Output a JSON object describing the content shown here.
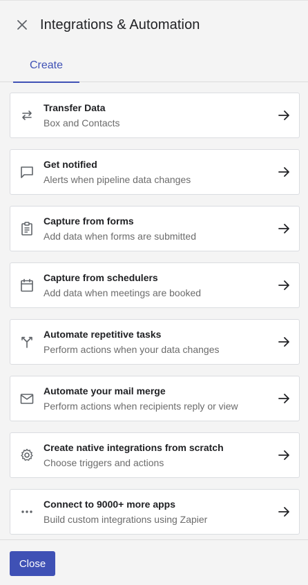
{
  "header": {
    "title": "Integrations & Automation",
    "close_icon": "close-icon"
  },
  "tabs": [
    {
      "label": "Create",
      "active": true
    }
  ],
  "items": [
    {
      "icon": "transfer-arrows-icon",
      "title": "Transfer Data",
      "subtitle": "Box and Contacts"
    },
    {
      "icon": "chat-bubble-icon",
      "title": "Get notified",
      "subtitle": "Alerts when pipeline data changes"
    },
    {
      "icon": "clipboard-icon",
      "title": "Capture from forms",
      "subtitle": "Add data when forms are submitted"
    },
    {
      "icon": "calendar-icon",
      "title": "Capture from schedulers",
      "subtitle": "Add data when meetings are booked"
    },
    {
      "icon": "merge-fork-icon",
      "title": "Automate repetitive tasks",
      "subtitle": "Perform actions when your data changes"
    },
    {
      "icon": "mail-icon",
      "title": "Automate your mail merge",
      "subtitle": "Perform actions when recipients reply or view"
    },
    {
      "icon": "gear-icon",
      "title": "Create native integrations from scratch",
      "subtitle": "Choose triggers and actions"
    },
    {
      "icon": "more-dots-icon",
      "title": "Connect to 9000+ more apps",
      "subtitle": "Build custom integrations using Zapier"
    }
  ],
  "footer": {
    "close_label": "Close"
  },
  "colors": {
    "accent": "#3f51b5",
    "background": "#f4f4f4",
    "card": "#ffffff"
  }
}
